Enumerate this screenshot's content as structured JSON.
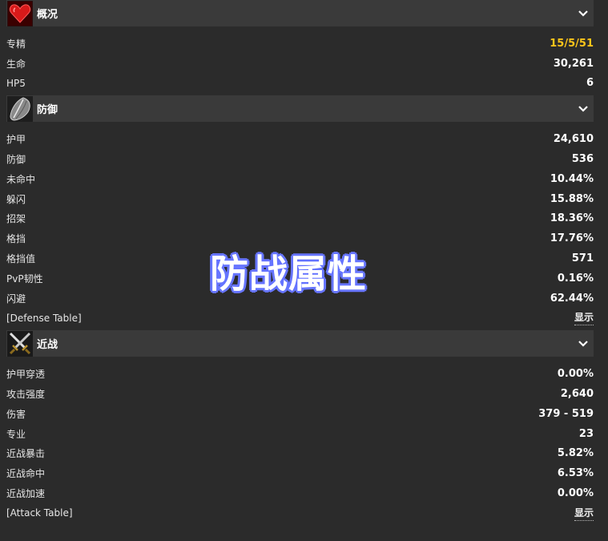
{
  "sections": [
    {
      "title": "概况",
      "icon": "heart-icon",
      "rows": [
        {
          "label": "专精",
          "value": "15/5/51",
          "color": "#ffc61a"
        },
        {
          "label": "生命",
          "value": "30,261"
        },
        {
          "label": "HP5",
          "value": "6"
        }
      ]
    },
    {
      "title": "防御",
      "icon": "shield-icon",
      "rows": [
        {
          "label": "护甲",
          "value": "24,610"
        },
        {
          "label": "防御",
          "value": "536"
        },
        {
          "label": "未命中",
          "value": "10.44%"
        },
        {
          "label": "躲闪",
          "value": "15.88%"
        },
        {
          "label": "招架",
          "value": "18.36%"
        },
        {
          "label": "格挡",
          "value": "17.76%"
        },
        {
          "label": "格挡值",
          "value": "571"
        },
        {
          "label": "PvP韧性",
          "value": "0.16%"
        },
        {
          "label": "闪避",
          "value": "62.44%"
        },
        {
          "label": "[Defense Table]",
          "value": "显示",
          "link": true
        }
      ]
    },
    {
      "title": "近战",
      "icon": "crossed-swords-icon",
      "rows": [
        {
          "label": "护甲穿透",
          "value": "0.00%"
        },
        {
          "label": "攻击强度",
          "value": "2,640"
        },
        {
          "label": "伤害",
          "value": "379 - 519"
        },
        {
          "label": "专业",
          "value": "23"
        },
        {
          "label": "近战暴击",
          "value": "5.82%"
        },
        {
          "label": "近战命中",
          "value": "6.53%"
        },
        {
          "label": "近战加速",
          "value": "0.00%"
        },
        {
          "label": "[Attack Table]",
          "value": "显示",
          "link": true
        }
      ]
    }
  ],
  "overlay_text": "防战属性",
  "colors": {
    "background": "#2b2b2b",
    "header_bg": "#3a3a3a",
    "accent_gold": "#ffc61a",
    "overlay_outline": "#6a78ff"
  }
}
